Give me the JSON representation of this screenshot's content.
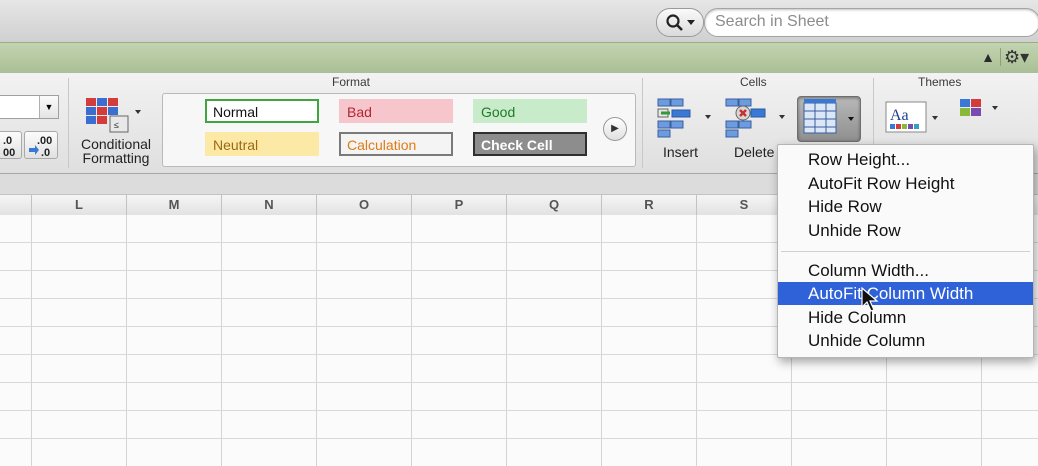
{
  "search": {
    "placeholder": "Search in Sheet"
  },
  "ribbon": {
    "groups": {
      "format": "Format",
      "cells": "Cells",
      "themes": "Themes"
    },
    "number": {
      "increase_decimal": ".0\n.00",
      "decrease_decimal": ".00\n.0"
    },
    "conditional_formatting": {
      "line1": "Conditional",
      "line2": "Formatting"
    },
    "styles": [
      {
        "label": "Normal",
        "bg": "#ffffff",
        "border": "#3fa63f",
        "color": "#111111"
      },
      {
        "label": "Bad",
        "bg": "#f7c6cc",
        "border": "#f7c6cc",
        "color": "#b3262f"
      },
      {
        "label": "Good",
        "bg": "#c8ecca",
        "border": "#c8ecca",
        "color": "#1f7a2b"
      },
      {
        "label": "Neutral",
        "bg": "#fde9a6",
        "border": "#fde9a6",
        "color": "#9a6a12"
      },
      {
        "label": "Calculation",
        "bg": "#f4f4f4",
        "border": "#7a7a7a",
        "color": "#e07b14"
      },
      {
        "label": "Check Cell",
        "bg": "#8d8d8d",
        "border": "#2f2f2f",
        "color": "#ffffff"
      }
    ],
    "cells": {
      "insert": "Insert",
      "delete": "Delete"
    }
  },
  "sheet": {
    "columns": [
      "L",
      "M",
      "N",
      "O",
      "P",
      "Q",
      "R",
      "S"
    ]
  },
  "format_menu": {
    "items_row": [
      "Row Height...",
      "AutoFit Row Height",
      "Hide Row",
      "Unhide Row"
    ],
    "items_col": [
      "Column Width...",
      "AutoFit Column Width",
      "Hide Column",
      "Unhide Column"
    ],
    "selected": "AutoFit Column Width"
  },
  "colors": {
    "ribbon_tab": "#b6c9a2",
    "menu_highlight": "#2f62d8"
  }
}
